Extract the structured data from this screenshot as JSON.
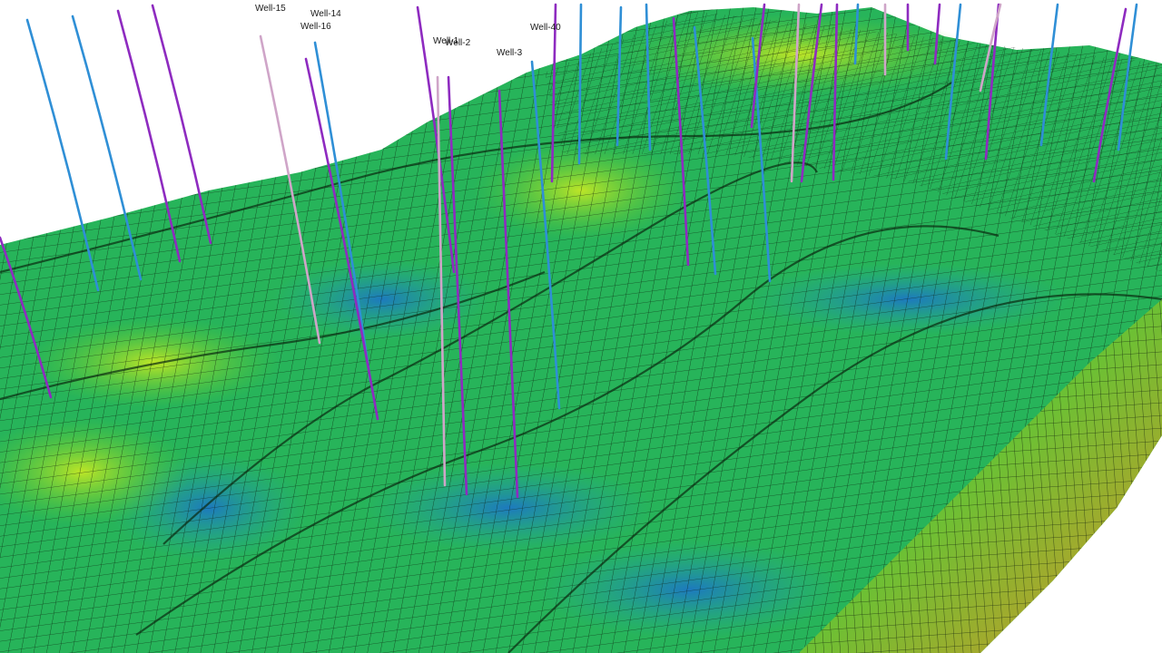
{
  "wells": [
    {
      "name": "Well-15",
      "color": "#c9a6c6"
    },
    {
      "name": "Well-14",
      "color": "#3a8fd0"
    },
    {
      "name": "Well-16",
      "color": "#8a2ab8"
    },
    {
      "name": "Well-1",
      "color": "#c9a6c6"
    },
    {
      "name": "Well-2",
      "color": "#8a2ab8"
    },
    {
      "name": "Well-3",
      "color": "#8a2ab8"
    },
    {
      "name": "Well-40",
      "color": "#3060c8"
    }
  ],
  "colors": {
    "background": "#ffffff",
    "grid_line": "#0b1a0b",
    "surface_low": "#1e88c8",
    "surface_mid": "#27b45a",
    "surface_high": "#b8e02a",
    "surface_extreme": "#e0781c",
    "well_blue": "#2f8fd6",
    "well_purple": "#8e2bc0",
    "well_pink": "#cfa5c8"
  }
}
